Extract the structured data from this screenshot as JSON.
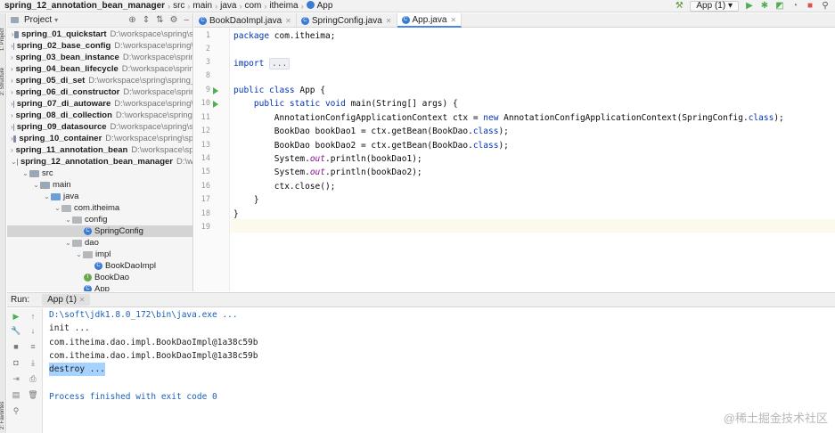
{
  "breadcrumb": {
    "items": [
      "spring_12_annotation_bean_manager",
      "src",
      "main",
      "java",
      "com",
      "itheima",
      "App"
    ]
  },
  "toolbar": {
    "run_config": "App (1)",
    "icons": [
      "hammer-icon",
      "run-icon",
      "debug-icon",
      "coverage-icon",
      "profile-icon",
      "stop-icon",
      "search-icon"
    ]
  },
  "left_strip": {
    "project_label": "1: Project",
    "structure_label": "2: Structure",
    "favorites_label": "2: Favorites"
  },
  "project_panel": {
    "title": "Project",
    "modules": [
      {
        "name": "spring_01_quickstart",
        "path": "D:\\workspace\\spring\\s"
      },
      {
        "name": "spring_02_base_config",
        "path": "D:\\workspace\\spring\\"
      },
      {
        "name": "spring_03_bean_instance",
        "path": "D:\\workspace\\spring"
      },
      {
        "name": "spring_04_bean_lifecycle",
        "path": "D:\\workspace\\spring"
      },
      {
        "name": "spring_05_di_set",
        "path": "D:\\workspace\\spring\\spring_"
      },
      {
        "name": "spring_06_di_constructor",
        "path": "D:\\workspace\\spring"
      },
      {
        "name": "spring_07_di_autoware",
        "path": "D:\\workspace\\spring\\"
      },
      {
        "name": "spring_08_di_collection",
        "path": "D:\\workspace\\spring\\"
      },
      {
        "name": "spring_09_datasource",
        "path": "D:\\workspace\\spring\\s"
      },
      {
        "name": "spring_10_container",
        "path": "D:\\workspace\\spring\\sp"
      },
      {
        "name": "spring_11_annotation_bean",
        "path": "D:\\workspace\\sprin"
      },
      {
        "name": "spring_12_annotation_bean_manager",
        "path": "D:\\w"
      }
    ],
    "tree": [
      "src",
      "main",
      "java",
      "com.itheima",
      "config",
      "SpringConfig",
      "dao",
      "impl",
      "BookDaoImpl",
      "BookDao",
      "App"
    ]
  },
  "tabs": [
    {
      "label": "BookDaoImpl.java"
    },
    {
      "label": "SpringConfig.java"
    },
    {
      "label": "App.java"
    }
  ],
  "editor": {
    "line_numbers": [
      "1",
      "2",
      "3",
      "8",
      "9",
      "10",
      "11",
      "12",
      "13",
      "14",
      "15",
      "16",
      "17",
      "18",
      "19"
    ],
    "lines": {
      "l1": "package com.itheima;",
      "l3": "import ...",
      "l9": "public class App {",
      "l10": "public static void main(String[] args) {",
      "l11": "AnnotationConfigApplicationContext ctx = new AnnotationConfigApplicationContext(SpringConfig.class);",
      "l12": "BookDao bookDao1 = ctx.getBean(BookDao.class);",
      "l13": "BookDao bookDao2 = ctx.getBean(BookDao.class);",
      "l14": "System.out.println(bookDao1);",
      "l15": "System.out.println(bookDao2);",
      "l16": "ctx.close();",
      "l17": "}",
      "l18": "}"
    }
  },
  "run_panel": {
    "label": "Run:",
    "tab": "App (1)",
    "output": [
      "D:\\soft\\jdk1.8.0_172\\bin\\java.exe ...",
      "init ...",
      "com.itheima.dao.impl.BookDaoImpl@1a38c59b",
      "com.itheima.dao.impl.BookDaoImpl@1a38c59b",
      "destroy ...",
      "Process finished with exit code 0"
    ]
  },
  "watermark": "@稀土掘金技术社区",
  "colors": {
    "keyword": "#0033b3",
    "static_field": "#871094",
    "run_green": "#4caf50",
    "selection": "#a6d2ff",
    "tab_accent": "#4a86e8"
  }
}
